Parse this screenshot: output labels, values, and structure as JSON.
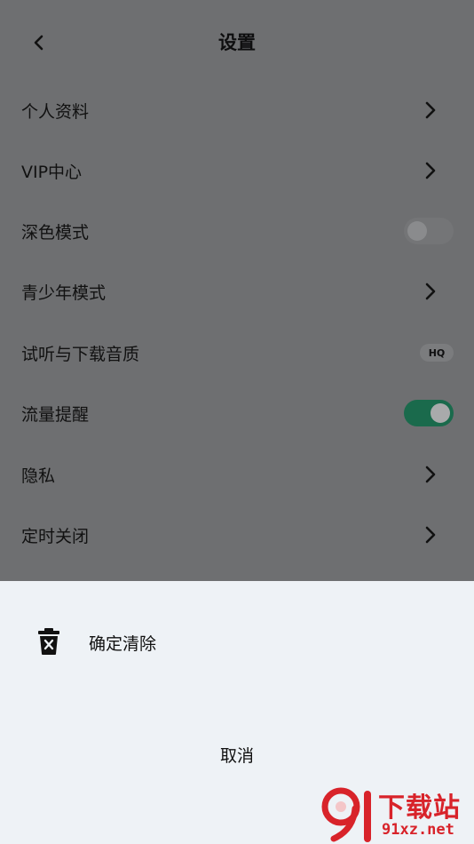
{
  "header": {
    "title": "设置"
  },
  "rows": [
    {
      "label": "个人资料",
      "control": "chevron"
    },
    {
      "label": "VIP中心",
      "control": "chevron"
    },
    {
      "label": "深色模式",
      "control": "toggle",
      "state": "off"
    },
    {
      "label": "青少年模式",
      "control": "chevron"
    },
    {
      "label": "试听与下载音质",
      "control": "badge",
      "badge": "HQ"
    },
    {
      "label": "流量提醒",
      "control": "toggle",
      "state": "on"
    },
    {
      "label": "隐私",
      "control": "chevron"
    },
    {
      "label": "定时关闭",
      "control": "chevron"
    }
  ],
  "sheet": {
    "action_label": "确定清除",
    "cancel_label": "取消"
  },
  "watermark": {
    "title": "下载站",
    "url": "91xz.net",
    "logo_text": "9"
  },
  "colors": {
    "toggle_on": "#1a6a4c",
    "watermark": "#d8232a",
    "sheet_bg": "#eef2f6"
  }
}
